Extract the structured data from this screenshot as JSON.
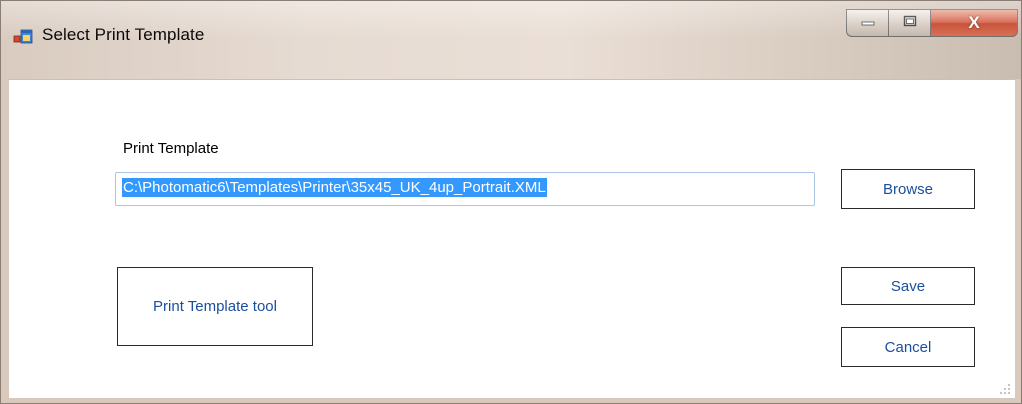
{
  "window": {
    "title": "Select Print Template",
    "icon": "app-window-icon",
    "controls": {
      "minimize_icon": "minimize-icon",
      "maximize_icon": "maximize-icon",
      "close_label": "X"
    }
  },
  "form": {
    "print_template_label": "Print Template",
    "print_template_path": "C:\\Photomatic6\\Templates\\Printer\\35x45_UK_4up_Portrait.XML",
    "browse_label": "Browse",
    "save_label": "Save",
    "cancel_label": "Cancel",
    "tool_label": "Print Template tool"
  },
  "colors": {
    "selection": "#3399ff",
    "button_text": "#1a4f9c",
    "input_border": "#a9c6e8",
    "close_button": "#c94a31"
  }
}
